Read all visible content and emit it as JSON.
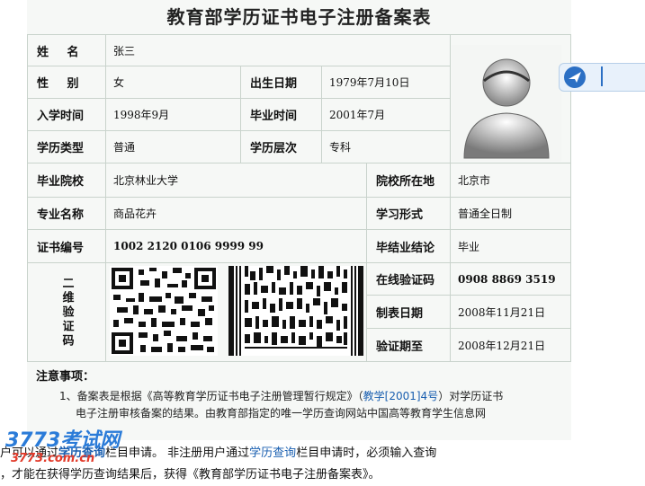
{
  "title": "教育部学历证书电子注册备案表",
  "fields": {
    "name_label": "姓    名",
    "name_value": "张三",
    "gender_label": "性    别",
    "gender_value": "女",
    "birth_label": "出生日期",
    "birth_value": "1979年7月10日",
    "enroll_label": "入学时间",
    "enroll_value": "1998年9月",
    "grad_label": "毕业时间",
    "grad_value": "2001年7月",
    "type_label": "学历类型",
    "type_value": "普通",
    "level_label": "学历层次",
    "level_value": "专科",
    "school_label": "毕业院校",
    "school_value": "北京林业大学",
    "location_label": "院校所在地",
    "location_value": "北京市",
    "major_label": "专业名称",
    "major_value": "商品花卉",
    "form_label": "学习形式",
    "form_value": "普通全日制",
    "cert_label": "证书编号",
    "cert_value": "1002 2120 0106 9999 99",
    "conclusion_label": "毕结业结论",
    "conclusion_value": "毕业",
    "qr_label": "二维验证码",
    "verify_label": "在线验证码",
    "verify_value": "0908 8869 3519",
    "made_label": "制表日期",
    "made_value": "2008年11月21日",
    "expire_label": "验证期至",
    "expire_value": "2008年12月21日"
  },
  "notes": {
    "title": "注意事项：",
    "line1_a": "1、备案表是根据《高等教育学历证书电子注册管理暂行规定》（",
    "line1_link": "教学[2001]4号",
    "line1_b": "）对学历证书",
    "line2": "电子注册审核备案的结果。由教育部指定的唯一学历查询网站中国高等教育学生信息网"
  },
  "footer": {
    "line1_a": "户可以通过",
    "line1_link1": "学历查询",
    "line1_b": "栏目申请。  非注册用户通过",
    "line1_link2": "学历查询",
    "line1_c": "栏目申请时，必须输入查询",
    "line2": "，才能在获得学历查询结果后，获得《教育部学历证书电子注册备案表》。"
  },
  "watermark": {
    "brand": "3773考试网",
    "url": "3773.com.cn"
  },
  "side_tab_icon": "bird-icon"
}
